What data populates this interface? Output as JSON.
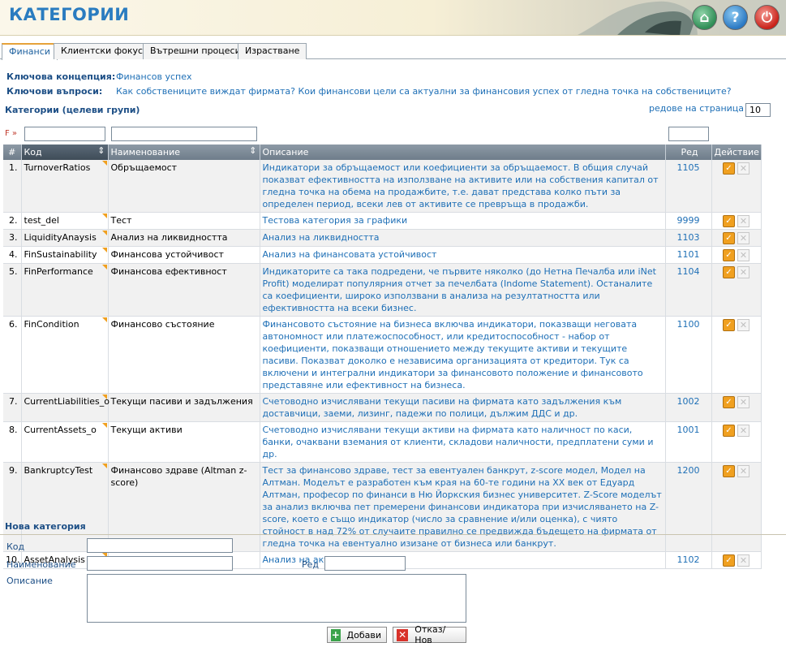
{
  "header": {
    "title": "КАТЕГОРИИ"
  },
  "tabs": [
    {
      "label": "Финанси",
      "active": true
    },
    {
      "label": "Клиентски фокус",
      "active": false
    },
    {
      "label": "Вътрешни процеси",
      "active": false
    },
    {
      "label": "Израстване",
      "active": false
    }
  ],
  "key_concept": {
    "label": "Ключова концепция:",
    "value": "Финансов успех"
  },
  "key_questions": {
    "label": "Ключови въпроси:",
    "value": "Как собствениците виждат фирмата? Кои финансови цели са актуални за финансовия успех от гледна точка на собствениците?"
  },
  "grid": {
    "title": "Категории (целеви групи)",
    "rows_per_page_label": "редове на страница »",
    "rows_per_page_value": "10",
    "filter_marker": "F »",
    "columns": {
      "num": "#",
      "code": "Код",
      "name": "Наименование",
      "desc": "Описание",
      "order": "Ред",
      "action": "Действие"
    },
    "rows": [
      {
        "n": "1.",
        "code": "TurnoverRatios",
        "name": "Обръщаемост",
        "desc": "Индикатори за обръщаемост или коефициенти за обръщаемост. В общия случай показват ефективността на използване на активите или на собствения капитал от гледна точка на обема на продажбите, т.е. дават представа колко пъти за определен период, всеки лев от активите се превръща в продажби.",
        "order": "1105"
      },
      {
        "n": "2.",
        "code": "test_del",
        "name": "Тест",
        "desc": "Тестова категория за графики",
        "order": "9999"
      },
      {
        "n": "3.",
        "code": "LiquidityAnaysis",
        "name": "Анализ на ликвидността",
        "desc": "Анализ на ликвидността",
        "order": "1103"
      },
      {
        "n": "4.",
        "code": "FinSustainability",
        "name": "Финансова устойчивост",
        "desc": "Анализ на финансовата устойчивост",
        "order": "1101"
      },
      {
        "n": "5.",
        "code": "FinPerformance",
        "name": "Финансова ефективност",
        "desc": "Индикаторите са така подредени, че първите няколко (до Нетна Печалба или iNet Profit) моделират популярния отчет за печелбата (Indome Statement). Останалите са коефициенти, широко използвани в анализа на резултатността или ефективността на всеки бизнес.",
        "order": "1104"
      },
      {
        "n": "6.",
        "code": "FinCondition",
        "name": "Финансово състояние",
        "desc": "Финансовото състояние на бизнеса включва индикатори, показващи неговата автономност или платежоспособност, или кредитоспособност - набор от коефициенти, показващи отношението между текущите активи и текущите пасиви. Показват доколко е независима организацията от кредитори. Тук са включени и интегрални индикатори за финансовото положение и финансовото представяне или ефективност на бизнеса.",
        "order": "1100"
      },
      {
        "n": "7.",
        "code": "CurrentLiabilities_o",
        "name": "Текущи пасиви и задължения",
        "desc": "Счетоводно изчислявани текущи пасиви на фирмата като задължения към доставчици, заеми, лизинг, падежи по полици, дължим ДДС и др.",
        "order": "1002"
      },
      {
        "n": "8.",
        "code": "CurrentAssets_o",
        "name": "Текущи активи",
        "desc": "Счетоводно изчислявани текущи активи на фирмата като наличност по каси, банки, очаквани вземания от клиенти, складови наличности, предплатени суми и др.",
        "order": "1001"
      },
      {
        "n": "9.",
        "code": "BankruptcyTest",
        "name": "Финансово здраве (Altman z-score)",
        "desc": "Тест за финансово здраве, тест за евентуален банкрут, z-score модел, Модел на Алтман. Моделът е разработен към края на 60-те години на ХХ век от Едуард Алтман, професор по финанси в Ню Йоркския бизнес университет. Z-Score моделът за анализ включва пет премерени финансови индикатора при изчисляването на Z-score, което е също индикатор (число за сравнение и/или оценка), с чиято стойност в над 72% от случаите правилно се предвижда бъдещето на фирмата от гледна точка на евентуално изизане от бизнеса или банкрут.",
        "order": "1200"
      },
      {
        "n": "10.",
        "code": "AssetAnalysis",
        "name": "Анализ на активите",
        "desc": "Анализ на активите",
        "order": "1102"
      }
    ]
  },
  "new_category": {
    "title": "Нова категория",
    "code_label": "Код",
    "name_label": "Наименование",
    "order_label": "Ред",
    "desc_label": "Описание",
    "add_button": "Добави",
    "cancel_button": "Отказ/Нов"
  }
}
